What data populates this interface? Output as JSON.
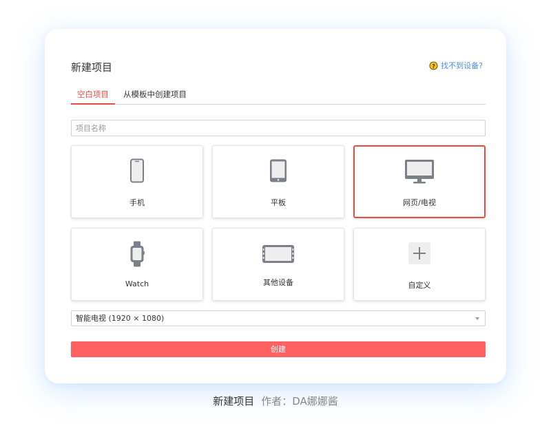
{
  "dialog": {
    "title": "新建项目",
    "help_link": "找不到设备?",
    "tabs": [
      {
        "label": "空白项目",
        "active": true
      },
      {
        "label": "从模板中创建项目",
        "active": false
      }
    ],
    "name_placeholder": "项目名称",
    "device_types": [
      {
        "label": "手机",
        "icon": "phone-icon",
        "selected": false
      },
      {
        "label": "平板",
        "icon": "tablet-icon",
        "selected": false
      },
      {
        "label": "网页/电视",
        "icon": "monitor-icon",
        "selected": true
      },
      {
        "label": "Watch",
        "icon": "watch-icon",
        "selected": false
      },
      {
        "label": "其他设备",
        "icon": "other-device-icon",
        "selected": false
      },
      {
        "label": "自定义",
        "icon": "plus-icon",
        "selected": false
      }
    ],
    "resolution_select": "智能电视 (1920 × 1080)",
    "create_button": "创建"
  },
  "caption": {
    "title": "新建项目",
    "author": "作者：DA娜娜酱"
  },
  "colors": {
    "accent": "#e84c3d",
    "create_button": "#ff6060",
    "link": "#4a90e2",
    "icon": "#7a7f8a"
  }
}
